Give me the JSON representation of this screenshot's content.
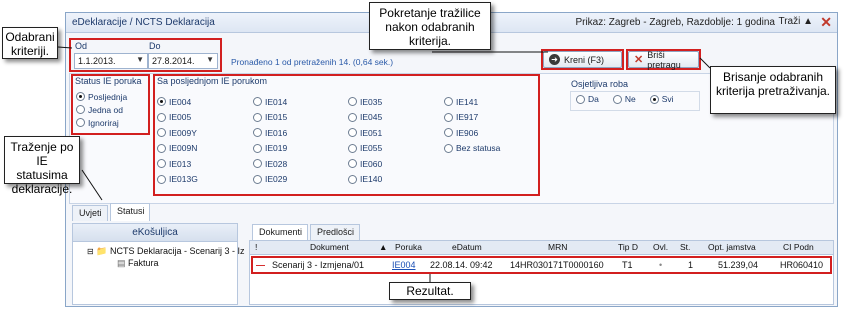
{
  "window": {
    "title": "eDeklaracije / NCTS Deklaracija",
    "view_info": "Prikaz: Zagreb - Zagreb, Razdoblje: 1 godina",
    "search_label": "Traži"
  },
  "date_filter": {
    "from_label": "Od",
    "from_value": "1.1.2013.",
    "to_label": "Do",
    "to_value": "27.8.2014."
  },
  "status_text": "Pronađeno 1 od pretraženih 14. (0,64 sek.)",
  "buttons": {
    "run": "Kreni (F3)",
    "clear": "Briši pretragu"
  },
  "status_group": {
    "title": "Status IE poruka",
    "options": [
      "Posljednja",
      "Jedna od",
      "Ignoriraj"
    ],
    "selected": "Posljednja"
  },
  "ie_group": {
    "title": "Sa posljednjom IE porukom",
    "selected": "IE004",
    "col1": [
      "IE004",
      "IE005",
      "IE009Y",
      "IE009N",
      "IE013",
      "IE013G"
    ],
    "col2": [
      "IE014",
      "IE015",
      "IE016",
      "IE019",
      "IE028",
      "IE029"
    ],
    "col3": [
      "IE035",
      "IE045",
      "IE051",
      "IE055",
      "IE060",
      "IE140"
    ],
    "col4": [
      "IE141",
      "IE917",
      "IE906",
      "Bez statusa"
    ]
  },
  "sensitive_goods": {
    "title": "Osjetljiva roba",
    "options": [
      "Da",
      "Ne",
      "Svi"
    ],
    "selected": "Svi"
  },
  "criteria_tabs": [
    "Uvjeti",
    "Statusi"
  ],
  "left_panel": {
    "title": "eKošuljica",
    "tree_root": "NCTS Deklaracija - Scenarij 3 - Iz",
    "tree_child": "Faktura"
  },
  "result_tabs": [
    "Dokumenti",
    "Predlošci"
  ],
  "grid": {
    "columns": [
      "!",
      "Dokument",
      "Poruka",
      "eDatum",
      "MRN",
      "Tip D",
      "Ovl.",
      "St.",
      "Opt. jamstva",
      "CI Podn"
    ],
    "row": {
      "dokument": "Scenarij 3 - Izmjena/01",
      "poruka": "IE004",
      "edatum": "22.08.14. 09:42",
      "mrn": "14HR030171T0000160",
      "tip": "T1",
      "ovl": "•",
      "st": "1",
      "jamstvo": "51.239,04",
      "ci": "HR060410"
    }
  },
  "callouts": {
    "criteria": "Odabrani kriteriji.",
    "run": "Pokretanje tražilice nakon odabranih kriterija.",
    "clear": "Brisanje odabranih kriterija pretraživanja.",
    "status": "Traženje po IE statusima deklaracije.",
    "result": "Rezultat."
  },
  "colors": {
    "annotation": "#d21f1f",
    "accent": "#1d3a6b",
    "link": "#1a4fb5"
  }
}
